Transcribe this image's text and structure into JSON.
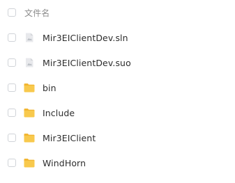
{
  "header": {
    "column_label": "文件名"
  },
  "files": [
    {
      "name": "Mir3EIClientDev.sln",
      "icon": "generic-file-icon",
      "type": "file"
    },
    {
      "name": "Mir3EIClientDev.suo",
      "icon": "generic-file-icon",
      "type": "file"
    },
    {
      "name": "bin",
      "icon": "folder-icon",
      "type": "folder"
    },
    {
      "name": "Include",
      "icon": "folder-icon",
      "type": "folder"
    },
    {
      "name": "Mir3EIClient",
      "icon": "folder-icon",
      "type": "folder"
    },
    {
      "name": "WindHorn",
      "icon": "folder-icon",
      "type": "folder"
    }
  ],
  "colors": {
    "folder": "#f8c94d",
    "folder_tab": "#f2b632",
    "file_body": "#e8e9ec",
    "file_mark": "#bcc0c6",
    "checkbox_border": "#d0d3d8",
    "text": "#2d2d2d",
    "header_text": "#8c8c8c"
  }
}
